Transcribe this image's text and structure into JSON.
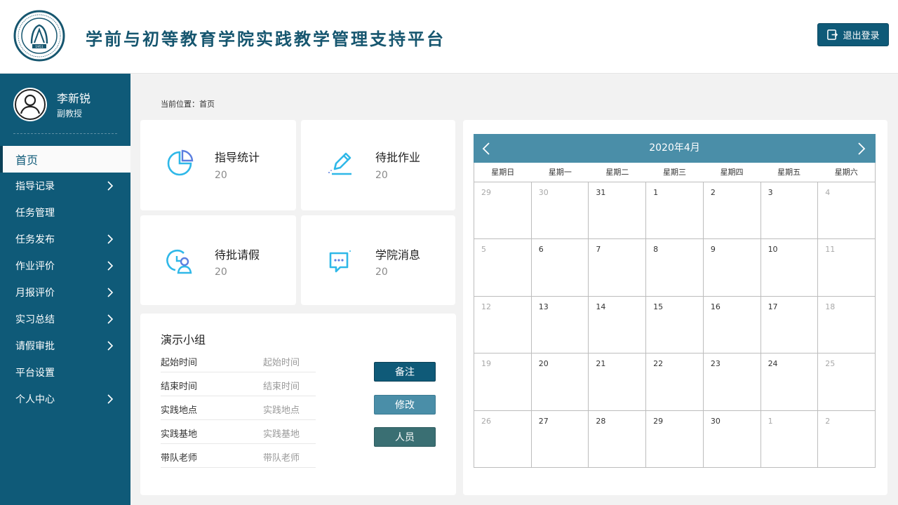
{
  "header": {
    "title": "学前与初等教育学院实践教学管理支持平台",
    "logout_label": "退出登录",
    "logo_icon": "university-seal-logo",
    "logo_year": "1951"
  },
  "sidebar": {
    "user": {
      "name": "李新锐",
      "role": "副教授"
    },
    "items": [
      {
        "label": "首页",
        "active": true,
        "has_arrow": false
      },
      {
        "label": "指导记录",
        "active": false,
        "has_arrow": true
      },
      {
        "label": "任务管理",
        "active": false,
        "has_arrow": false
      },
      {
        "label": "任务发布",
        "active": false,
        "has_arrow": true
      },
      {
        "label": "作业评价",
        "active": false,
        "has_arrow": true
      },
      {
        "label": "月报评价",
        "active": false,
        "has_arrow": true
      },
      {
        "label": "实习总结",
        "active": false,
        "has_arrow": true
      },
      {
        "label": "请假审批",
        "active": false,
        "has_arrow": true
      },
      {
        "label": "平台设置",
        "active": false,
        "has_arrow": false
      },
      {
        "label": "个人中心",
        "active": false,
        "has_arrow": true
      }
    ]
  },
  "breadcrumb": "当前位置：首页",
  "stats": [
    {
      "title": "指导统计",
      "value": "20",
      "icon": "pie-chart-icon"
    },
    {
      "title": "待批作业",
      "value": "20",
      "icon": "edit-pen-icon"
    },
    {
      "title": "待批请假",
      "value": "20",
      "icon": "clock-user-icon"
    },
    {
      "title": "学院消息",
      "value": "20",
      "icon": "message-chat-icon"
    }
  ],
  "group": {
    "title": "演示小组",
    "rows": [
      {
        "label": "起始时间",
        "value": "起始时间"
      },
      {
        "label": "结束时间",
        "value": "结束时间"
      },
      {
        "label": "实践地点",
        "value": "实践地点"
      },
      {
        "label": "实践基地",
        "value": "实践基地"
      },
      {
        "label": "带队老师",
        "value": "带队老师"
      }
    ],
    "buttons": [
      {
        "label": "备注",
        "color": "#0f5a78"
      },
      {
        "label": "修改",
        "color": "#4a8ea8"
      },
      {
        "label": "人员",
        "color": "#3a6f73"
      }
    ]
  },
  "calendar": {
    "month_label": "2020年4月",
    "weekdays": [
      "星期日",
      "星期一",
      "星期二",
      "星期三",
      "星期四",
      "星期五",
      "星期六"
    ],
    "weeks": [
      [
        {
          "d": "29",
          "m": true
        },
        {
          "d": "30",
          "m": true
        },
        {
          "d": "31",
          "m": false
        },
        {
          "d": "1",
          "m": false
        },
        {
          "d": "2",
          "m": false
        },
        {
          "d": "3",
          "m": false
        },
        {
          "d": "4",
          "m": true
        }
      ],
      [
        {
          "d": "5",
          "m": true
        },
        {
          "d": "6",
          "m": false
        },
        {
          "d": "7",
          "m": false
        },
        {
          "d": "8",
          "m": false
        },
        {
          "d": "9",
          "m": false
        },
        {
          "d": "10",
          "m": false
        },
        {
          "d": "11",
          "m": true
        }
      ],
      [
        {
          "d": "12",
          "m": true
        },
        {
          "d": "13",
          "m": false
        },
        {
          "d": "14",
          "m": false
        },
        {
          "d": "15",
          "m": false
        },
        {
          "d": "16",
          "m": false
        },
        {
          "d": "17",
          "m": false
        },
        {
          "d": "18",
          "m": true
        }
      ],
      [
        {
          "d": "19",
          "m": true
        },
        {
          "d": "20",
          "m": false
        },
        {
          "d": "21",
          "m": false
        },
        {
          "d": "22",
          "m": false
        },
        {
          "d": "23",
          "m": false
        },
        {
          "d": "24",
          "m": false
        },
        {
          "d": "25",
          "m": true
        }
      ],
      [
        {
          "d": "26",
          "m": true
        },
        {
          "d": "27",
          "m": false
        },
        {
          "d": "28",
          "m": false
        },
        {
          "d": "29",
          "m": false
        },
        {
          "d": "30",
          "m": false
        },
        {
          "d": "1",
          "m": true
        },
        {
          "d": "2",
          "m": true
        }
      ]
    ]
  },
  "colors": {
    "primary": "#0f5a78",
    "calendar_header": "#4a8ea8",
    "icon_accent": "#2fb8e8"
  }
}
